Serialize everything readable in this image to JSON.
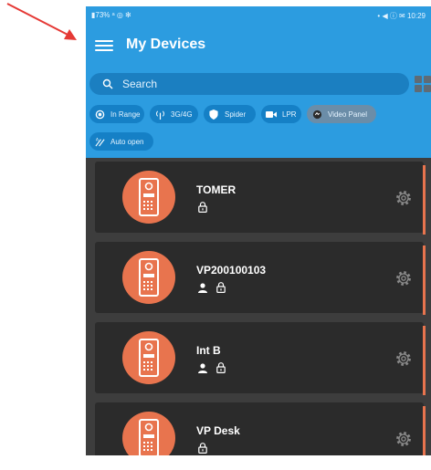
{
  "status_bar": {
    "left": "▮73% ᵃ ◎ ✻",
    "right": "• ◀ ⓘ ✉ 10:29"
  },
  "header": {
    "title": "My Devices",
    "menu_icon": "hamburger-icon",
    "view_toggle_icon": "grid-icon"
  },
  "search": {
    "placeholder": "Search",
    "icon": "search-icon"
  },
  "filters": [
    {
      "label": "In Range",
      "icon": "target-icon",
      "active": false
    },
    {
      "label": "3G/4G",
      "icon": "antenna-icon",
      "active": false
    },
    {
      "label": "Spider",
      "icon": "shield-icon",
      "active": false
    },
    {
      "label": "LPR",
      "icon": "camera-icon",
      "active": false
    },
    {
      "label": "Video Panel",
      "icon": "video-panel-icon",
      "active": true
    },
    {
      "label": "Auto open",
      "icon": "auto-open-icon",
      "active": false
    }
  ],
  "devices": [
    {
      "name": "TOMER",
      "badges": [
        "lock-icon"
      ]
    },
    {
      "name": "VP200100103",
      "badges": [
        "user-icon",
        "lock-icon"
      ]
    },
    {
      "name": "Int B",
      "badges": [
        "user-icon",
        "lock-icon"
      ]
    },
    {
      "name": "VP Desk",
      "badges": [
        "lock-icon"
      ]
    }
  ],
  "colors": {
    "header": "#2c9ce0",
    "search_bg": "#1b7fc1",
    "chip_bg": "#1580c6",
    "chip_active_bg": "#6b8da8",
    "list_bg": "#3d3d3d",
    "card_bg": "#2b2b2b",
    "accent": "#e8744e",
    "annotation_arrow": "#e53935"
  }
}
